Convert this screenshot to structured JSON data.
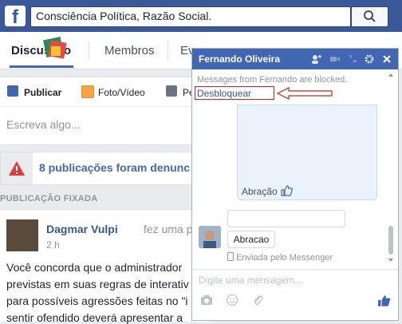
{
  "search": {
    "value": "Consciência Política, Razão Social."
  },
  "tabs": [
    {
      "label": "Discussão"
    },
    {
      "label": "Membros"
    },
    {
      "label": "Ev"
    }
  ],
  "composer": {
    "publish_label": "Publicar",
    "photo_label": "Foto/Vídeo",
    "poll_label": "Pe",
    "placeholder": "Escreva algo..."
  },
  "alert": {
    "text": "8 publicações foram denunc"
  },
  "pinned_label": "PUBLICAÇÃO FIXADA",
  "post": {
    "author": "Dagmar Vulpi",
    "action": "fez uma pergu",
    "time": "2 h",
    "lines": [
      "Você concorda que o administrador",
      "previstas em suas regras de interativ",
      "para possíveis agressões feitas no \"i",
      "sentir ofendido deverá apresentar a"
    ]
  },
  "chat": {
    "name": "Fernando Oliveira",
    "blocked_text": "Messages from Fernando are blocked.",
    "unblock_label": "Desbloquear",
    "prev_message": "Abração",
    "message": "Abracao",
    "sent_via": "Enviada pelo Messenger",
    "input_placeholder": "Digite uma mensagem..."
  },
  "colors": {
    "brand": "#3b5998",
    "chat_header": "#4267b2",
    "alert_red": "#dd3c3c",
    "annotation_red": "#cc2222"
  }
}
